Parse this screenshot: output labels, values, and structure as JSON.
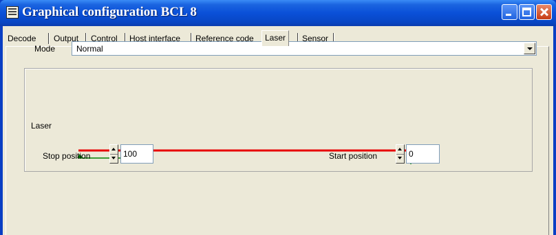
{
  "window": {
    "title": "Graphical configuration BCL 8"
  },
  "tabs": [
    {
      "label": "Decode",
      "selected": false
    },
    {
      "label": "Output",
      "selected": false
    },
    {
      "label": "Control",
      "selected": false
    },
    {
      "label": "Host interface",
      "selected": false
    },
    {
      "label": "Reference code",
      "selected": false
    },
    {
      "label": "Laser",
      "selected": true
    },
    {
      "label": "Sensor",
      "selected": false
    }
  ],
  "mode": {
    "label": "Mode",
    "value": "Normal"
  },
  "laser": {
    "label": "Laser",
    "beam_color": "#e80000",
    "arrow_color": "#008000",
    "stop_position": {
      "label": "Stop position",
      "value": "100"
    },
    "start_position": {
      "label": "Start position",
      "value": "0"
    }
  }
}
